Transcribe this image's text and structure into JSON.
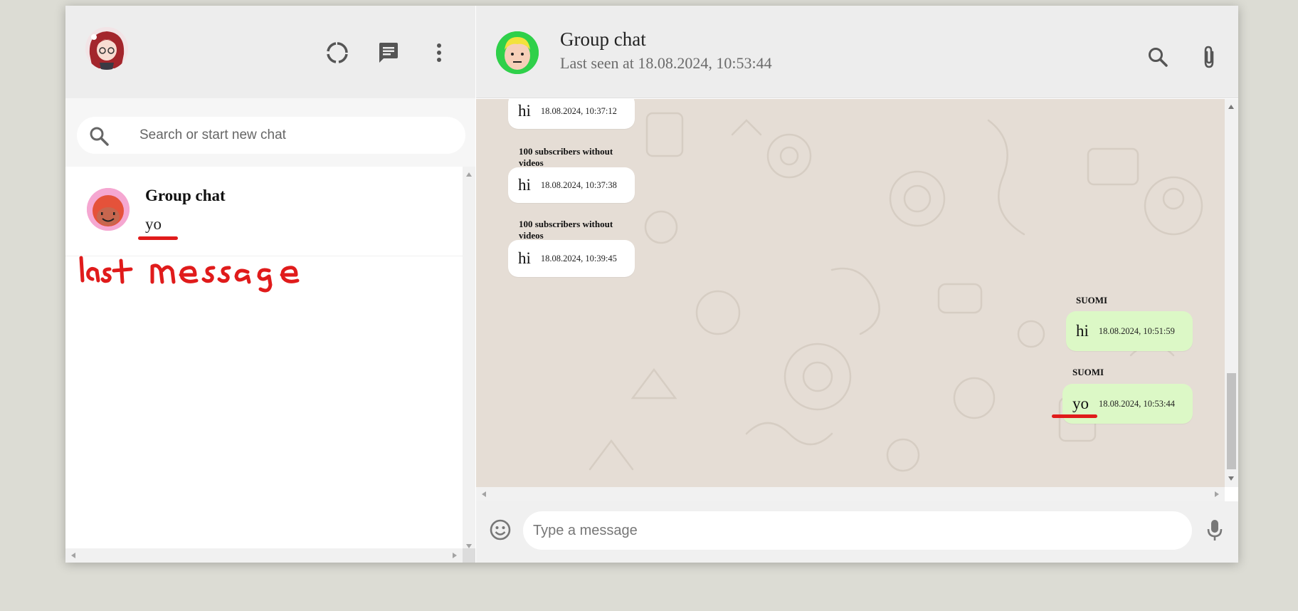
{
  "left_header": {
    "avatar_icon": "anime-avatar",
    "icons": [
      "status-icon",
      "new-chat-icon",
      "menu-icon"
    ]
  },
  "search": {
    "placeholder": "Search or start new chat"
  },
  "chats": [
    {
      "name": "Group chat",
      "last_message": "yo",
      "avatar_icon": "smiley-avatar"
    }
  ],
  "annotations": {
    "handwritten_label": "last message"
  },
  "conversation": {
    "title": "Group chat",
    "status": "Last seen at 18.08.2024, 10:53:44",
    "icons": [
      "search-icon",
      "attach-icon",
      "menu-icon"
    ]
  },
  "messages": [
    {
      "direction": "in",
      "sender": "",
      "text": "hi",
      "time": "18.08.2024, 10:37:12"
    },
    {
      "direction": "in",
      "sender": "100 subscribers without videos",
      "text": "hi",
      "time": "18.08.2024, 10:37:38"
    },
    {
      "direction": "in",
      "sender": "100 subscribers without videos",
      "text": "hi",
      "time": "18.08.2024, 10:39:45"
    },
    {
      "direction": "out",
      "sender": "SUOMI",
      "text": "hi",
      "time": "18.08.2024, 10:51:59"
    },
    {
      "direction": "out",
      "sender": "SUOMI",
      "text": "yo",
      "time": "18.08.2024, 10:53:44"
    }
  ],
  "composer": {
    "placeholder": "Type a message"
  },
  "colors": {
    "outgoing": "#dcf8c6",
    "incoming": "#ffffff",
    "chat_bg": "#e5ddd5",
    "annotation": "#e01b1b"
  }
}
